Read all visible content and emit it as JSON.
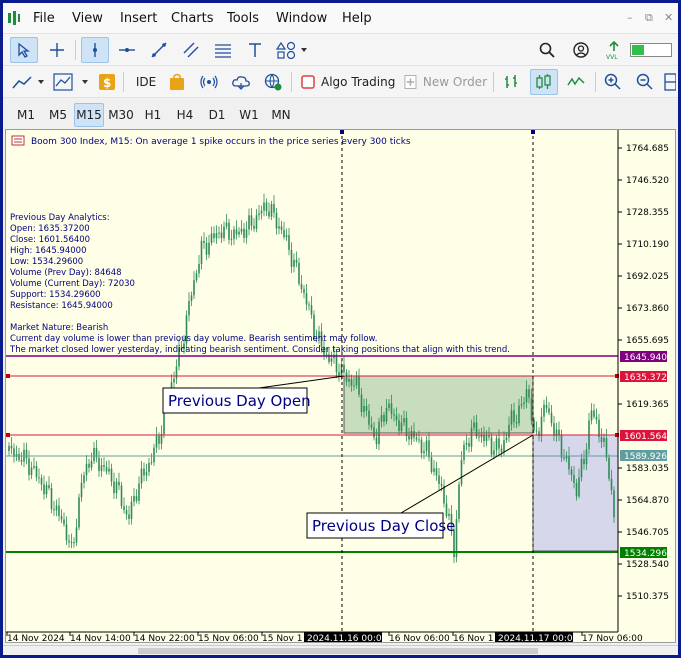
{
  "menu": {
    "file": "File",
    "view": "View",
    "insert": "Insert",
    "charts": "Charts",
    "tools": "Tools",
    "window": "Window",
    "help": "Help"
  },
  "toolbar": {
    "ide": "IDE",
    "algo_trading": "Algo Trading",
    "new_order": "New Order"
  },
  "timeframes": [
    "M1",
    "M5",
    "M15",
    "M30",
    "H1",
    "H4",
    "D1",
    "W1",
    "MN"
  ],
  "active_timeframe": "M15",
  "chart": {
    "header": "Boom 300 Index, M15:  On average 1 spike occurs in the price series every 300 ticks",
    "analytics": [
      "Previous Day Analytics:",
      "Open: 1635.37200",
      "Close: 1601.56400",
      "High: 1645.94000",
      "Low: 1534.29600",
      "Volume (Prev Day): 84648",
      "Volume (Current Day): 72030",
      "Support: 1534.29600",
      "Resistance: 1645.94000",
      "",
      "Market Nature: Bearish",
      "Current day volume is lower than previous day volume. Bearish sentiment may follow.",
      "The market closed lower yesterday, indicating bearish sentiment. Consider taking positions that align with this trend."
    ],
    "annotations": {
      "open_label": "Previous Day Open",
      "close_label": "Previous Day Close"
    },
    "price_ticks": [
      "1764.685",
      "1746.520",
      "1728.355",
      "1710.190",
      "1692.025",
      "1673.860",
      "1655.695",
      "1619.365",
      "1583.035",
      "1564.870",
      "1546.705",
      "1528.540",
      "1510.375"
    ],
    "price_labels": {
      "resistance": "1645.940",
      "open": "1635.372",
      "close": "1601.564",
      "current": "1589.926",
      "support": "1534.296"
    },
    "time_ticks": [
      "14 Nov 2024",
      "14 Nov 14:00",
      "14 Nov 22:00",
      "15 Nov 06:00",
      "15 Nov 1",
      "16 Nov 06:00",
      "16 Nov 1",
      "17 Nov 06:00"
    ],
    "time_markers": [
      "2024.11.16 00:00",
      "2024.11.17 00:00"
    ],
    "colors": {
      "background": "#ffffe8",
      "candle": "#2e8b57",
      "resistance": "#800080",
      "open": "#dc143c",
      "close": "#dc143c",
      "current": "#5f9ea0",
      "support": "#008000",
      "prev_day_box": "#8fbc8f",
      "today_box": "#b0b0f0"
    }
  }
}
